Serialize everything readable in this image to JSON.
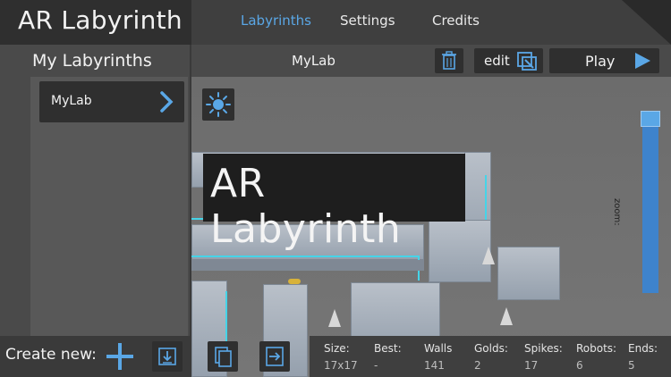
{
  "header": {
    "app_title": "AR Labyrinth",
    "tabs": [
      {
        "label": "Labyrinths",
        "active": true
      },
      {
        "label": "Settings",
        "active": false
      },
      {
        "label": "Credits",
        "active": false
      }
    ]
  },
  "sidebar": {
    "title": "My Labyrinths",
    "items": [
      {
        "label": "MyLab"
      }
    ]
  },
  "toolbar": {
    "current_lab": "MyLab",
    "edit_label": "edit",
    "play_label": "Play"
  },
  "viewport": {
    "overlay_title": "AR Labyrinth",
    "zoom_label": "zoom:",
    "zoom_level": 1.0
  },
  "create": {
    "label": "Create new:"
  },
  "stats": {
    "headers": [
      "Size:",
      "Best:",
      "Walls",
      "Golds:",
      "Spikes:",
      "Robots:",
      "Ends:"
    ],
    "values": [
      "17x17",
      "-",
      "141",
      "2",
      "17",
      "6",
      "5"
    ]
  },
  "colors": {
    "accent": "#5aa7e6",
    "zoom_track": "#3e83cc",
    "laser": "#45d4e8"
  },
  "icons": [
    "sun-icon",
    "chevron-right-icon",
    "trash-icon",
    "edit-icon",
    "play-icon",
    "plus-icon",
    "download-icon",
    "copy-icon",
    "export-icon"
  ]
}
